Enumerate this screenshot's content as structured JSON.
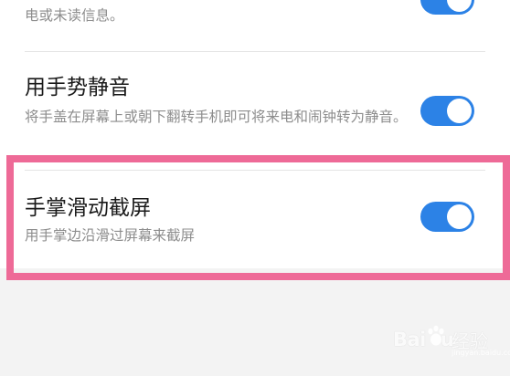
{
  "settings": {
    "items": [
      {
        "title": "",
        "description": "电或未读信息。",
        "enabled": true
      },
      {
        "title": "用手势静音",
        "description": "将手盖在屏幕上或朝下翻转手机即可将来电和闹钟转为静音。",
        "enabled": true
      },
      {
        "title": "手掌滑动截屏",
        "description": "用手掌边沿滑过屏幕来截屏",
        "enabled": true
      }
    ]
  },
  "highlight": {
    "color": "#ee6a97"
  },
  "colors": {
    "toggle_on": "#2c82e6",
    "background": "#f3f3f3"
  },
  "watermark": {
    "brand": "Bai",
    "brand_suffix": "u",
    "chinese": "经验",
    "sub": "jingyan.baidu.com"
  }
}
